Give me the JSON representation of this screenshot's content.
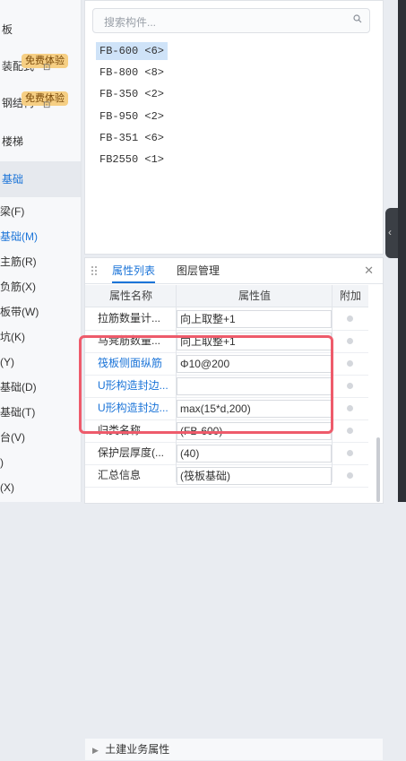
{
  "sidebar": {
    "items": [
      {
        "label": "板",
        "active": false
      },
      {
        "label": "装配式",
        "badge": "免费体验",
        "locked": true
      },
      {
        "label": "钢结构",
        "badge": "免费体验",
        "locked": true
      },
      {
        "label": "楼梯",
        "active": false
      },
      {
        "label": "基础",
        "active": true
      }
    ],
    "tree": [
      {
        "label": "梁(F)",
        "active": false
      },
      {
        "label": "基础(M)",
        "active": true
      },
      {
        "label": "主筋(R)",
        "active": false
      },
      {
        "label": "负筋(X)",
        "active": false
      },
      {
        "label": "板带(W)",
        "active": false
      },
      {
        "label": "坑(K)",
        "active": false
      },
      {
        "label": "(Y)",
        "active": false
      },
      {
        "label": "基础(D)",
        "active": false
      },
      {
        "label": "基础(T)",
        "active": false
      },
      {
        "label": "台(V)",
        "active": false
      },
      {
        "label": ")",
        "active": false
      },
      {
        "label": "(X)",
        "active": false
      }
    ]
  },
  "component_panel": {
    "search_placeholder": "搜索构件...",
    "components": [
      {
        "label": "FB-600 <6>",
        "selected": true
      },
      {
        "label": "FB-800 <8>",
        "selected": false
      },
      {
        "label": "FB-350 <2>",
        "selected": false
      },
      {
        "label": "FB-950 <2>",
        "selected": false
      },
      {
        "label": "FB-351 <6>",
        "selected": false
      },
      {
        "label": "FB2550 <1>",
        "selected": false
      }
    ]
  },
  "property_panel": {
    "tabs": [
      {
        "label": "属性列表",
        "active": true
      },
      {
        "label": "图层管理",
        "active": false
      }
    ],
    "headers": {
      "name": "属性名称",
      "value": "属性值",
      "extra": "附加"
    },
    "rows": [
      {
        "name": "拉筋数量计...",
        "value": "向上取整+1",
        "blue": false
      },
      {
        "name": "马凳筋数量...",
        "value": "向上取整+1",
        "blue": false
      },
      {
        "name": "筏板侧面纵筋",
        "value": "Φ10@200",
        "blue": true
      },
      {
        "name": "U形构造封边...",
        "value": "",
        "blue": true
      },
      {
        "name": "U形构造封边...",
        "value": "max(15*d,200)",
        "blue": true
      },
      {
        "name": "归类名称",
        "value": "(FB-600)",
        "blue": false
      },
      {
        "name": "保护层厚度(...",
        "value": "(40)",
        "blue": false
      },
      {
        "name": "汇总信息",
        "value": "(筏板基础)",
        "blue": false
      }
    ],
    "group_footer": "土建业务属性"
  },
  "colors": {
    "accent": "#1b74d8",
    "highlight": "#ee5b6b",
    "badge": "#f6cf84"
  }
}
